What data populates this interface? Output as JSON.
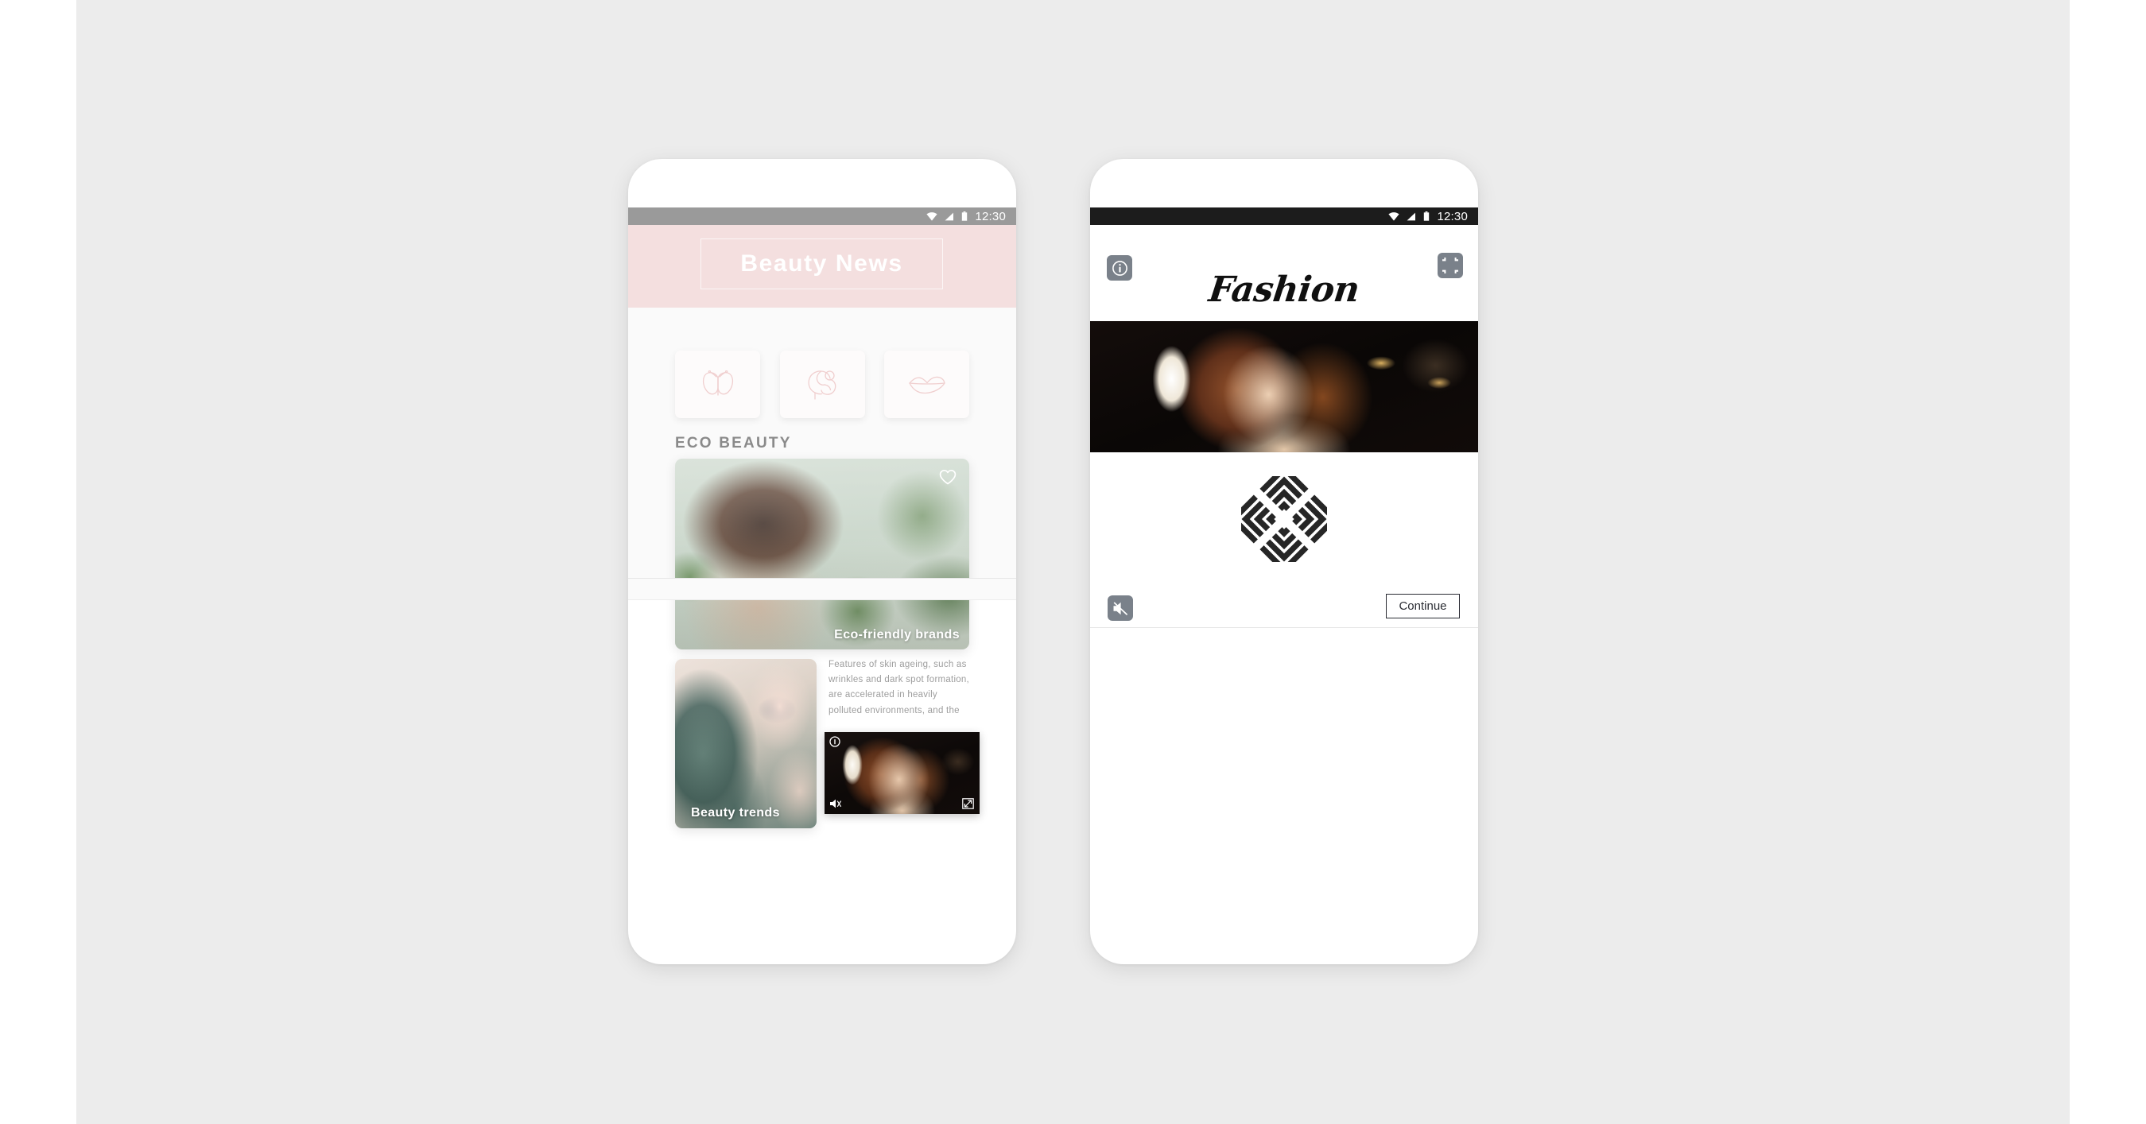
{
  "canvas": {
    "background_color": "#ececec",
    "page_color": "#ffffff"
  },
  "phones": {
    "left": {
      "name": "beauty-news-app",
      "status_bar": {
        "time": "12:30",
        "background_color": "#9a9a9a",
        "icons": [
          "wifi-icon",
          "cellular-signal-icon",
          "battery-icon"
        ]
      },
      "header": {
        "title": "Beauty News",
        "background_color": "#f4dfdf",
        "title_color": "#ffffff"
      },
      "categories": [
        {
          "name": "butterfly-icon",
          "label": "Butterfly"
        },
        {
          "name": "woman-profile-icon",
          "label": "Hair"
        },
        {
          "name": "lips-icon",
          "label": "Lips"
        }
      ],
      "section_title": "ECO BEAUTY",
      "cards": [
        {
          "name": "eco-friendly-brands-card",
          "label": "Eco-friendly brands",
          "favorite_icon": "heart-icon",
          "favorited": false
        },
        {
          "name": "beauty-trends-card",
          "label": "Beauty trends"
        }
      ],
      "article_text": "Features of skin ageing, such as wrinkles and dark spot formation, are accelerated in heavily polluted environments, and the",
      "video_overlay": {
        "name": "floating-video-player",
        "controls": [
          "info-icon",
          "mute-icon",
          "expand-icon"
        ]
      }
    },
    "right": {
      "name": "fashion-app",
      "status_bar": {
        "time": "12:30",
        "background_color": "#1c1c1c",
        "icons": [
          "wifi-icon",
          "cellular-signal-icon",
          "battery-icon"
        ]
      },
      "top_controls": {
        "info_label": "i",
        "info_icon": "info-icon",
        "collapse_icon": "collapse-fullscreen-icon"
      },
      "brand_title": "Fashion",
      "logo": {
        "name": "diamond-chevron-logo",
        "color": "#262626"
      },
      "bottom_controls": {
        "mute_icon": "mute-icon",
        "continue_label": "Continue"
      }
    }
  }
}
